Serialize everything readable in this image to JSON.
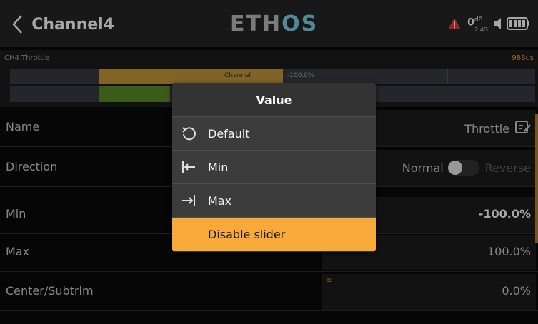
{
  "header": {
    "title": "Channel4",
    "logo_prefix": "ETH",
    "logo_highlight": "OS",
    "rssi_value": "0",
    "rssi_unit": "dB",
    "rssi_band": "2.4G"
  },
  "monitor": {
    "channel_label": "CH4  Throttle",
    "pulse": "988us",
    "bar_tag": "Channel",
    "bar_value": "-100.0%"
  },
  "rows": [
    {
      "label": "Name",
      "value": "Throttle"
    },
    {
      "label": "Direction",
      "value": "Normal",
      "alt": "Reverse"
    },
    {
      "label": "Min",
      "value": "-100.0%"
    },
    {
      "label": "Max",
      "value": "100.0%"
    },
    {
      "label": "Center/Subtrim",
      "value": "0.0%"
    }
  ],
  "popup": {
    "title": "Value",
    "items": [
      {
        "label": "Default",
        "icon": "reset-icon"
      },
      {
        "label": "Min",
        "icon": "min-icon"
      },
      {
        "label": "Max",
        "icon": "max-icon"
      },
      {
        "label": "Disable slider",
        "icon": ""
      }
    ]
  },
  "colors": {
    "accent": "#f7a93a",
    "warning": "#e53935",
    "logo_highlight": "#7fd3e6"
  }
}
